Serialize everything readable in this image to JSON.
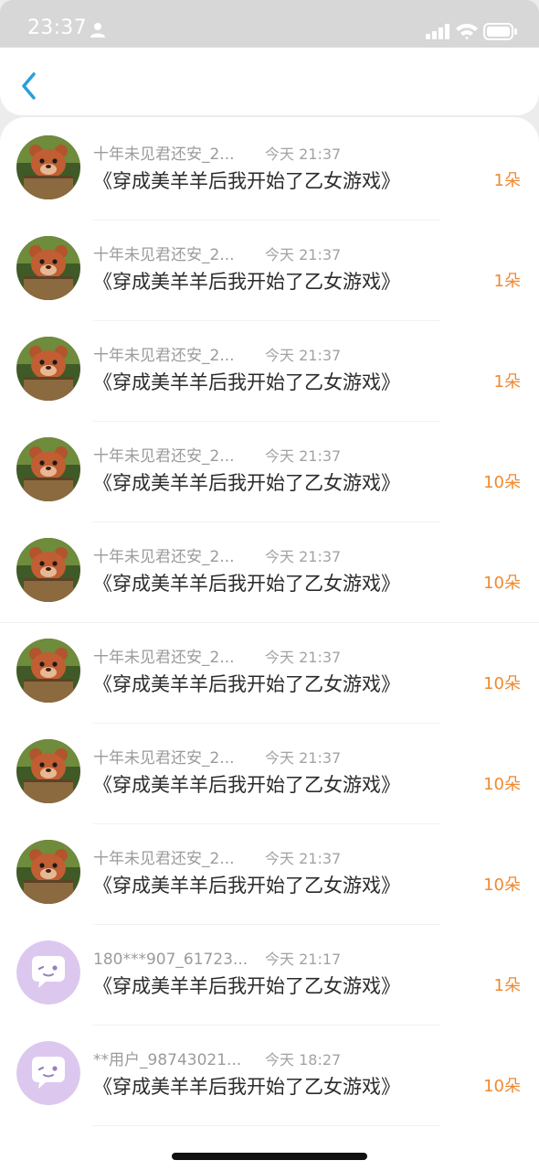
{
  "status_bar": {
    "time": "23:37",
    "icons": [
      "person-icon",
      "cellular-signal-icon",
      "wifi-icon",
      "battery-icon"
    ]
  },
  "nav": {
    "back_icon": "chevron-left-icon"
  },
  "colors": {
    "accent": "#f0892f",
    "back_arrow": "#2a9fd9",
    "status_bar_bg": "#d7d7d7",
    "default_avatar_bg": "#dcc8ef"
  },
  "rows": [
    {
      "user": "十年未见君还安_2...",
      "time": "今天 21:37",
      "title": "《穿成美羊羊后我开始了乙女游戏》",
      "count": "1朵",
      "avatar": "bear-avatar"
    },
    {
      "user": "十年未见君还安_2...",
      "time": "今天 21:37",
      "title": "《穿成美羊羊后我开始了乙女游戏》",
      "count": "1朵",
      "avatar": "bear-avatar"
    },
    {
      "user": "十年未见君还安_2...",
      "time": "今天 21:37",
      "title": "《穿成美羊羊后我开始了乙女游戏》",
      "count": "1朵",
      "avatar": "bear-avatar"
    },
    {
      "user": "十年未见君还安_2...",
      "time": "今天 21:37",
      "title": "《穿成美羊羊后我开始了乙女游戏》",
      "count": "10朵",
      "avatar": "bear-avatar"
    },
    {
      "user": "十年未见君还安_2...",
      "time": "今天 21:37",
      "title": "《穿成美羊羊后我开始了乙女游戏》",
      "count": "10朵",
      "avatar": "bear-avatar"
    },
    {
      "user": "十年未见君还安_2...",
      "time": "今天 21:37",
      "title": "《穿成美羊羊后我开始了乙女游戏》",
      "count": "10朵",
      "avatar": "bear-avatar"
    },
    {
      "user": "十年未见君还安_2...",
      "time": "今天 21:37",
      "title": "《穿成美羊羊后我开始了乙女游戏》",
      "count": "10朵",
      "avatar": "bear-avatar"
    },
    {
      "user": "十年未见君还安_2...",
      "time": "今天 21:37",
      "title": "《穿成美羊羊后我开始了乙女游戏》",
      "count": "10朵",
      "avatar": "bear-avatar"
    },
    {
      "user": "180***907_61723...",
      "time": "今天 21:17",
      "title": "《穿成美羊羊后我开始了乙女游戏》",
      "count": "1朵",
      "avatar": "default-chat-avatar"
    },
    {
      "user": "**用户_98743021...",
      "time": "今天 18:27",
      "title": "《穿成美羊羊后我开始了乙女游戏》",
      "count": "10朵",
      "avatar": "default-chat-avatar"
    }
  ]
}
